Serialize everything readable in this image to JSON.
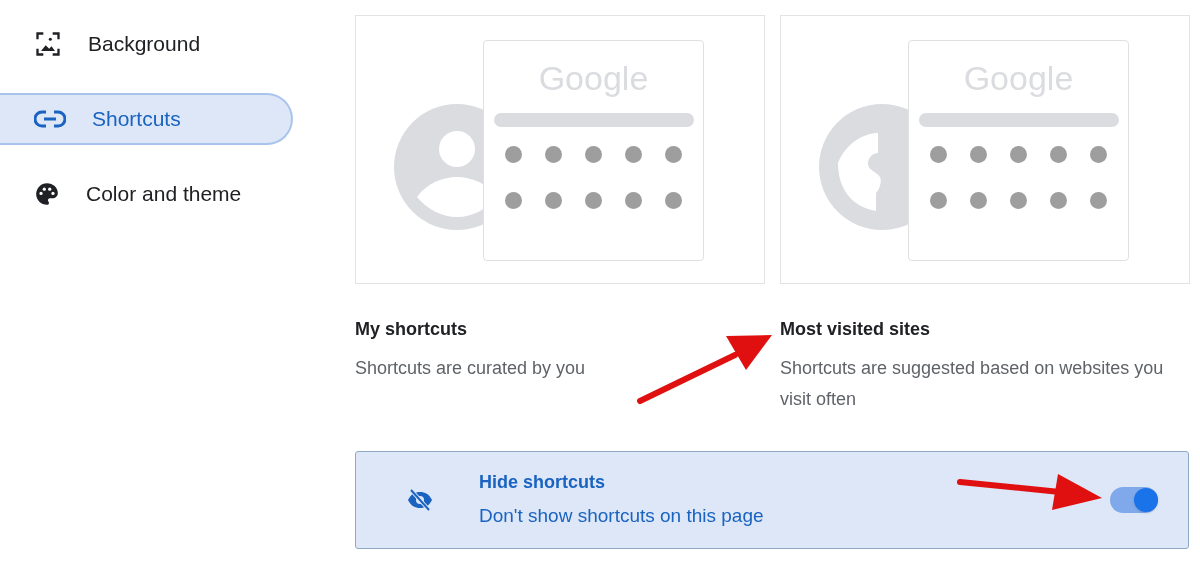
{
  "sidebar": {
    "items": [
      {
        "label": "Background",
        "kind": "image",
        "selected": false
      },
      {
        "label": "Shortcuts",
        "kind": "link",
        "selected": true
      },
      {
        "label": "Color and theme",
        "kind": "palette",
        "selected": false
      }
    ]
  },
  "options": [
    {
      "kind": "user",
      "logo": "Google",
      "title": "My shortcuts",
      "description": "Shortcuts are curated by you"
    },
    {
      "kind": "globe",
      "logo": "Google",
      "title": "Most visited sites",
      "description": "Shortcuts are suggested based on websites you visit often"
    }
  ],
  "hide_shortcuts": {
    "title": "Hide shortcuts",
    "description": "Don't show shortcuts on this page",
    "on": true
  }
}
